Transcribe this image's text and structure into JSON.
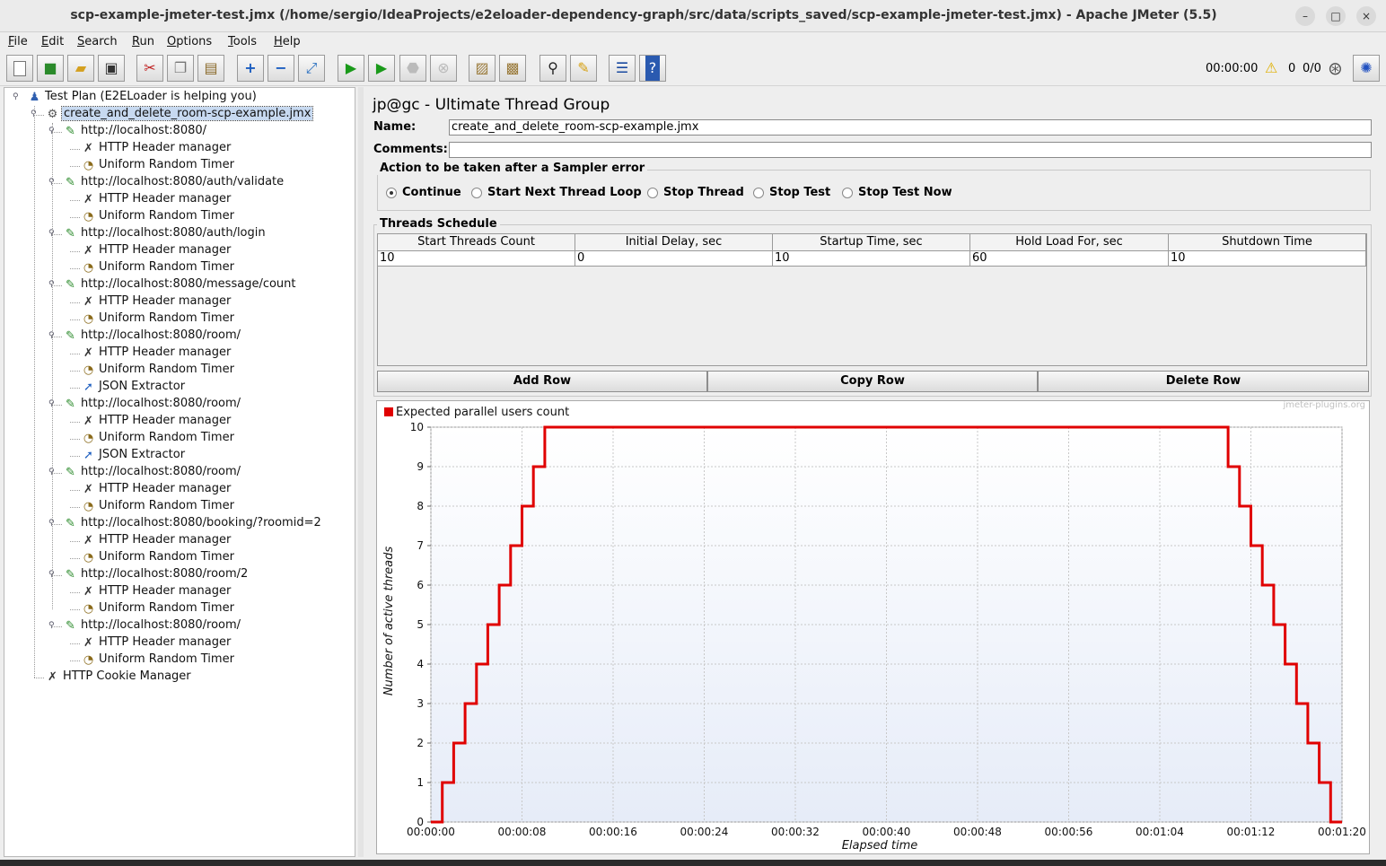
{
  "window": {
    "title": "scp-example-jmeter-test.jmx (/home/sergio/IdeaProjects/e2eloader-dependency-graph/src/data/scripts_saved/scp-example-jmeter-test.jmx) - Apache JMeter (5.5)",
    "minimize": "–",
    "maximize": "□",
    "close": "×"
  },
  "menu": [
    "File",
    "Edit",
    "Search",
    "Run",
    "Options",
    "Tools",
    "Help"
  ],
  "toolbar": {
    "icons": [
      "new-icon",
      "templates-icon",
      "open-icon",
      "save-icon",
      "cut-icon",
      "copy-icon",
      "paste-icon",
      "expand-icon",
      "collapse-icon",
      "toggle-icon",
      "start-icon",
      "start-no-pauses-icon",
      "stop-icon",
      "shutdown-icon",
      "clear-icon",
      "clear-all-icon",
      "search-icon",
      "reset-search-icon",
      "function-helper-icon",
      "help-icon"
    ],
    "elapsed": "00:00:00",
    "warnings": "0",
    "threads": "0/0"
  },
  "tree": {
    "root": "Test Plan (E2ELoader is helping you)",
    "group": "create_and_delete_room-scp-example.jmx",
    "items": [
      {
        "label": "http://localhost:8080/",
        "kind": "sampler",
        "level": 2
      },
      {
        "label": "HTTP Header manager",
        "kind": "config",
        "level": 3
      },
      {
        "label": "Uniform Random Timer",
        "kind": "timer",
        "level": 3
      },
      {
        "label": "http://localhost:8080/auth/validate",
        "kind": "sampler",
        "level": 2
      },
      {
        "label": "HTTP Header manager",
        "kind": "config",
        "level": 3
      },
      {
        "label": "Uniform Random Timer",
        "kind": "timer",
        "level": 3
      },
      {
        "label": "http://localhost:8080/auth/login",
        "kind": "sampler",
        "level": 2
      },
      {
        "label": "HTTP Header manager",
        "kind": "config",
        "level": 3
      },
      {
        "label": "Uniform Random Timer",
        "kind": "timer",
        "level": 3
      },
      {
        "label": "http://localhost:8080/message/count",
        "kind": "sampler",
        "level": 2
      },
      {
        "label": "HTTP Header manager",
        "kind": "config",
        "level": 3
      },
      {
        "label": "Uniform Random Timer",
        "kind": "timer",
        "level": 3
      },
      {
        "label": "http://localhost:8080/room/",
        "kind": "sampler",
        "level": 2
      },
      {
        "label": "HTTP Header manager",
        "kind": "config",
        "level": 3
      },
      {
        "label": "Uniform Random Timer",
        "kind": "timer",
        "level": 3
      },
      {
        "label": "JSON Extractor",
        "kind": "extractor",
        "level": 3
      },
      {
        "label": "http://localhost:8080/room/",
        "kind": "sampler",
        "level": 2
      },
      {
        "label": "HTTP Header manager",
        "kind": "config",
        "level": 3
      },
      {
        "label": "Uniform Random Timer",
        "kind": "timer",
        "level": 3
      },
      {
        "label": "JSON Extractor",
        "kind": "extractor",
        "level": 3
      },
      {
        "label": "http://localhost:8080/room/",
        "kind": "sampler",
        "level": 2
      },
      {
        "label": "HTTP Header manager",
        "kind": "config",
        "level": 3
      },
      {
        "label": "Uniform Random Timer",
        "kind": "timer",
        "level": 3
      },
      {
        "label": "http://localhost:8080/booking/?roomid=2",
        "kind": "sampler",
        "level": 2
      },
      {
        "label": "HTTP Header manager",
        "kind": "config",
        "level": 3
      },
      {
        "label": "Uniform Random Timer",
        "kind": "timer",
        "level": 3
      },
      {
        "label": "http://localhost:8080/room/2",
        "kind": "sampler",
        "level": 2
      },
      {
        "label": "HTTP Header manager",
        "kind": "config",
        "level": 3
      },
      {
        "label": "Uniform Random Timer",
        "kind": "timer",
        "level": 3
      },
      {
        "label": "http://localhost:8080/room/",
        "kind": "sampler",
        "level": 2
      },
      {
        "label": "HTTP Header manager",
        "kind": "config",
        "level": 3
      },
      {
        "label": "Uniform Random Timer",
        "kind": "timer",
        "level": 3
      }
    ],
    "cookie_manager": "HTTP Cookie Manager"
  },
  "panel": {
    "heading": "jp@gc - Ultimate Thread Group",
    "name_label": "Name:",
    "name_value": "create_and_delete_room-scp-example.jmx",
    "comments_label": "Comments:",
    "comments_value": "",
    "error_section": "Action to be taken after a Sampler error",
    "error_options": [
      "Continue",
      "Start Next Thread Loop",
      "Stop Thread",
      "Stop Test",
      "Stop Test Now"
    ],
    "error_selected": "Continue",
    "schedule_section": "Threads Schedule",
    "columns": [
      "Start Threads Count",
      "Initial Delay, sec",
      "Startup Time, sec",
      "Hold Load For, sec",
      "Shutdown Time"
    ],
    "rows": [
      [
        "10",
        "0",
        "10",
        "60",
        "10"
      ]
    ],
    "buttons": {
      "add": "Add Row",
      "copy": "Copy Row",
      "delete": "Delete Row"
    }
  },
  "chart_data": {
    "type": "line",
    "watermark": "jmeter-plugins.org",
    "legend": "Expected parallel users count",
    "legend_placement": "top-left",
    "line_color": "#e00000",
    "xlabel": "Elapsed time",
    "ylabel": "Number of active threads",
    "x_tick_labels": [
      "00:00:00",
      "00:00:08",
      "00:00:16",
      "00:00:24",
      "00:00:32",
      "00:00:40",
      "00:00:48",
      "00:00:56",
      "00:01:04",
      "00:01:12",
      "00:01:20"
    ],
    "y_tick_labels": [
      "0",
      "1",
      "2",
      "3",
      "4",
      "5",
      "6",
      "7",
      "8",
      "9",
      "10"
    ],
    "xlim": [
      0,
      80
    ],
    "ylim": [
      0,
      10
    ],
    "grid": true,
    "x_seconds": [
      0,
      1,
      1,
      2,
      2,
      3,
      3,
      4,
      4,
      5,
      5,
      6,
      6,
      7,
      7,
      8,
      8,
      9,
      9,
      10,
      10,
      70,
      70,
      71,
      71,
      72,
      72,
      73,
      73,
      74,
      74,
      75,
      75,
      76,
      76,
      77,
      77,
      78,
      78,
      79,
      79,
      80
    ],
    "y_threads": [
      0,
      0,
      1,
      1,
      2,
      2,
      3,
      3,
      4,
      4,
      5,
      5,
      6,
      6,
      7,
      7,
      8,
      8,
      9,
      9,
      10,
      10,
      9,
      9,
      8,
      8,
      7,
      7,
      6,
      6,
      5,
      5,
      4,
      4,
      3,
      3,
      2,
      2,
      1,
      1,
      0,
      0
    ]
  }
}
